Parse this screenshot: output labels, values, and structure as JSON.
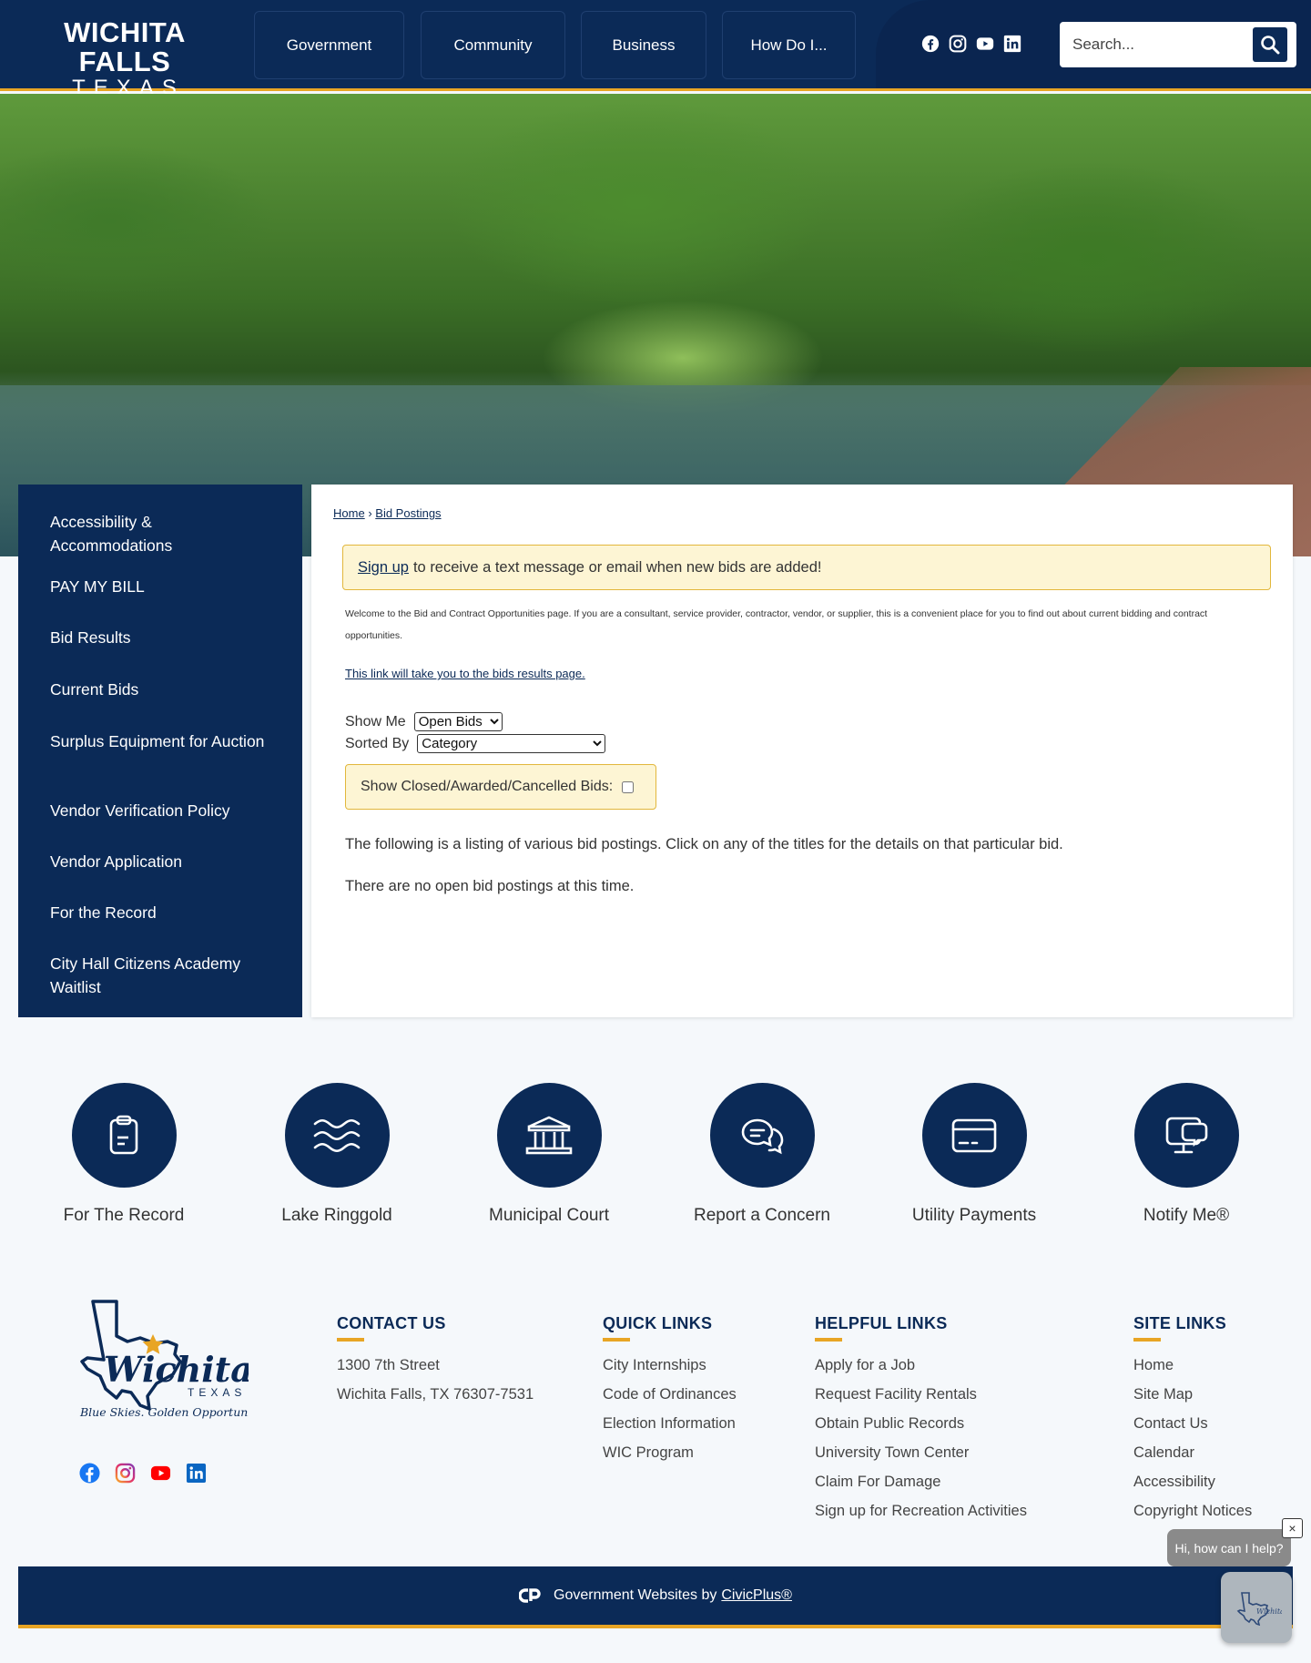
{
  "header": {
    "logo_line1": "WICHITA FALLS",
    "logo_line2": "TEXAS",
    "nav": [
      "Government",
      "Community",
      "Business",
      "How Do I..."
    ],
    "social": [
      "facebook-icon",
      "instagram-icon",
      "youtube-icon",
      "linkedin-icon"
    ],
    "search_placeholder": "Search..."
  },
  "sidebar": {
    "items": [
      "Accessibility & Accommodations",
      "PAY MY BILL",
      "Bid Results",
      "Current Bids",
      "Surplus Equipment for Auction",
      "Vendor Verification Policy",
      "Vendor Application",
      "For the Record",
      "City Hall Citizens Academy Waitlist"
    ]
  },
  "main": {
    "breadcrumb": {
      "home": "Home",
      "separator": "›",
      "current": "Bid Postings"
    },
    "alert": {
      "link": "Sign up",
      "text": "to receive a text message or email when new bids are added!"
    },
    "intro": "Welcome to the Bid and Contract Opportunities page. If you are a consultant, service provider, contractor, vendor, or supplier, this is a convenient place for you to find out about current bidding and contract opportunities.",
    "results_link": "This link will take you to the bids results page.",
    "show_me": {
      "label": "Show Me",
      "value": "Open Bids"
    },
    "sorted_by": {
      "label": "Sorted By",
      "value": "Category"
    },
    "closed_label": "Show Closed/Awarded/Cancelled Bids:",
    "listing_text": "The following is a listing of various bid postings. Click on any of the titles for the details on that particular bid.",
    "empty_text": "There are no open bid postings at this time."
  },
  "quick_links": [
    {
      "label": "For The Record",
      "icon": "clipboard-icon"
    },
    {
      "label": "Lake Ringgold",
      "icon": "waves-icon"
    },
    {
      "label": "Municipal Court",
      "icon": "courthouse-icon"
    },
    {
      "label": "Report a Concern",
      "icon": "chat-bubbles-icon"
    },
    {
      "label": "Utility Payments",
      "icon": "credit-card-icon"
    },
    {
      "label": "Notify Me®",
      "icon": "notify-monitor-icon"
    }
  ],
  "footer": {
    "logo_text": "Wichita Falls",
    "logo_sub": "TEXAS",
    "tagline": "Blue Skies. Golden Opportunities.",
    "contact": {
      "heading": "CONTACT US",
      "lines": [
        "1300 7th Street",
        "Wichita Falls, TX 76307-7531"
      ]
    },
    "quick": {
      "heading": "QUICK LINKS",
      "links": [
        "City Internships",
        "Code of Ordinances",
        "Election Information",
        "WIC Program"
      ]
    },
    "helpful": {
      "heading": "HELPFUL LINKS",
      "links": [
        "Apply for a Job",
        "Request Facility Rentals",
        "Obtain Public Records",
        "University Town Center",
        "Claim For Damage",
        "Sign up for Recreation Activities"
      ]
    },
    "site": {
      "heading": "SITE LINKS",
      "links": [
        "Home",
        "Site Map",
        "Contact Us",
        "Calendar",
        "Accessibility",
        "Copyright Notices"
      ]
    },
    "powered_prefix": "Government Websites by",
    "powered_link": "CivicPlus®"
  },
  "chat": {
    "bubble": "Hi, how can I help?",
    "close": "×"
  },
  "colors": {
    "navy": "#0b2a57",
    "gold": "#e8a524",
    "alert_bg": "#fdf5d4"
  }
}
